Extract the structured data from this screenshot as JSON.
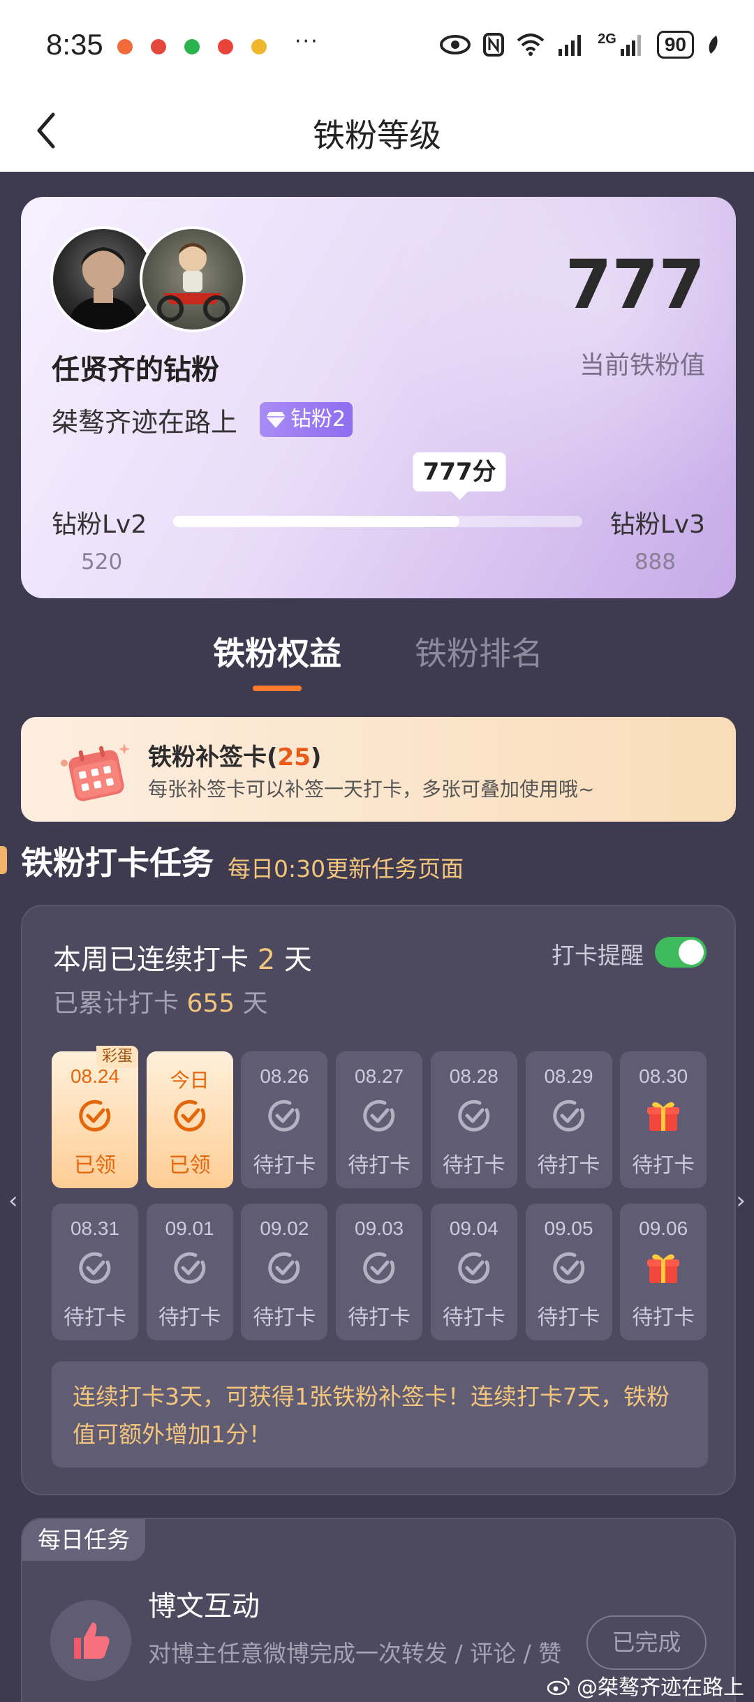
{
  "status_bar": {
    "time": "8:35",
    "more": "···",
    "network": "2G",
    "battery": "90"
  },
  "nav": {
    "title": "铁粉等级"
  },
  "profile": {
    "fan_title": "任贤齐的钻粉",
    "username": "桀骜齐迹在路上",
    "badge": "钻粉2",
    "score": "777",
    "score_label": "当前铁粉值",
    "level_current": "钻粉Lv2",
    "level_next": "钻粉Lv3",
    "level_current_value": "520",
    "level_next_value": "888",
    "progress_label": "777分",
    "progress_fraction": 0.7
  },
  "tabs": [
    {
      "label": "铁粉权益",
      "active": true
    },
    {
      "label": "铁粉排名",
      "active": false
    }
  ],
  "makeup_card": {
    "title_prefix": "铁粉补签卡(",
    "count": "25",
    "title_suffix": ")",
    "desc": "每张补签卡可以补签一天打卡，多张可叠加使用哦~"
  },
  "checkin_section": {
    "title": "铁粉打卡任务",
    "subtitle": "每日0:30更新任务页面"
  },
  "checkin": {
    "streak_prefix": "本周已连续打卡 ",
    "streak_days": "2",
    "streak_suffix": " 天",
    "total_prefix": "已累计打卡 ",
    "total_days": "655",
    "total_suffix": " 天",
    "remind_label": "打卡提醒",
    "remind_on": true,
    "egg_tag": "彩蛋",
    "days": [
      {
        "date": "08.24",
        "status": "已领",
        "done": true,
        "gift": false,
        "egg": true
      },
      {
        "date": "今日",
        "status": "已领",
        "done": true,
        "gift": false,
        "egg": false
      },
      {
        "date": "08.26",
        "status": "待打卡",
        "done": false,
        "gift": false,
        "egg": false
      },
      {
        "date": "08.27",
        "status": "待打卡",
        "done": false,
        "gift": false,
        "egg": false
      },
      {
        "date": "08.28",
        "status": "待打卡",
        "done": false,
        "gift": false,
        "egg": false
      },
      {
        "date": "08.29",
        "status": "待打卡",
        "done": false,
        "gift": false,
        "egg": false
      },
      {
        "date": "08.30",
        "status": "待打卡",
        "done": false,
        "gift": true,
        "egg": false
      },
      {
        "date": "08.31",
        "status": "待打卡",
        "done": false,
        "gift": false,
        "egg": false
      },
      {
        "date": "09.01",
        "status": "待打卡",
        "done": false,
        "gift": false,
        "egg": false
      },
      {
        "date": "09.02",
        "status": "待打卡",
        "done": false,
        "gift": false,
        "egg": false
      },
      {
        "date": "09.03",
        "status": "待打卡",
        "done": false,
        "gift": false,
        "egg": false
      },
      {
        "date": "09.04",
        "status": "待打卡",
        "done": false,
        "gift": false,
        "egg": false
      },
      {
        "date": "09.05",
        "status": "待打卡",
        "done": false,
        "gift": false,
        "egg": false
      },
      {
        "date": "09.06",
        "status": "待打卡",
        "done": false,
        "gift": true,
        "egg": false
      }
    ],
    "reward_note": "连续打卡3天，可获得1张铁粉补签卡！连续打卡7天，铁粉值可额外增加1分！"
  },
  "daily_tasks": {
    "tag": "每日任务",
    "items": [
      {
        "title": "博文互动",
        "desc": "对博主任意微博完成一次转发 / 评论 / 赞",
        "button": "已完成"
      }
    ]
  },
  "watermark": "@桀骜齐迹在路上",
  "colors": {
    "accent": "#ff7a2a",
    "gold": "#f3c57d",
    "background": "#3e3b50",
    "toggle_on": "#3dbb5d"
  }
}
